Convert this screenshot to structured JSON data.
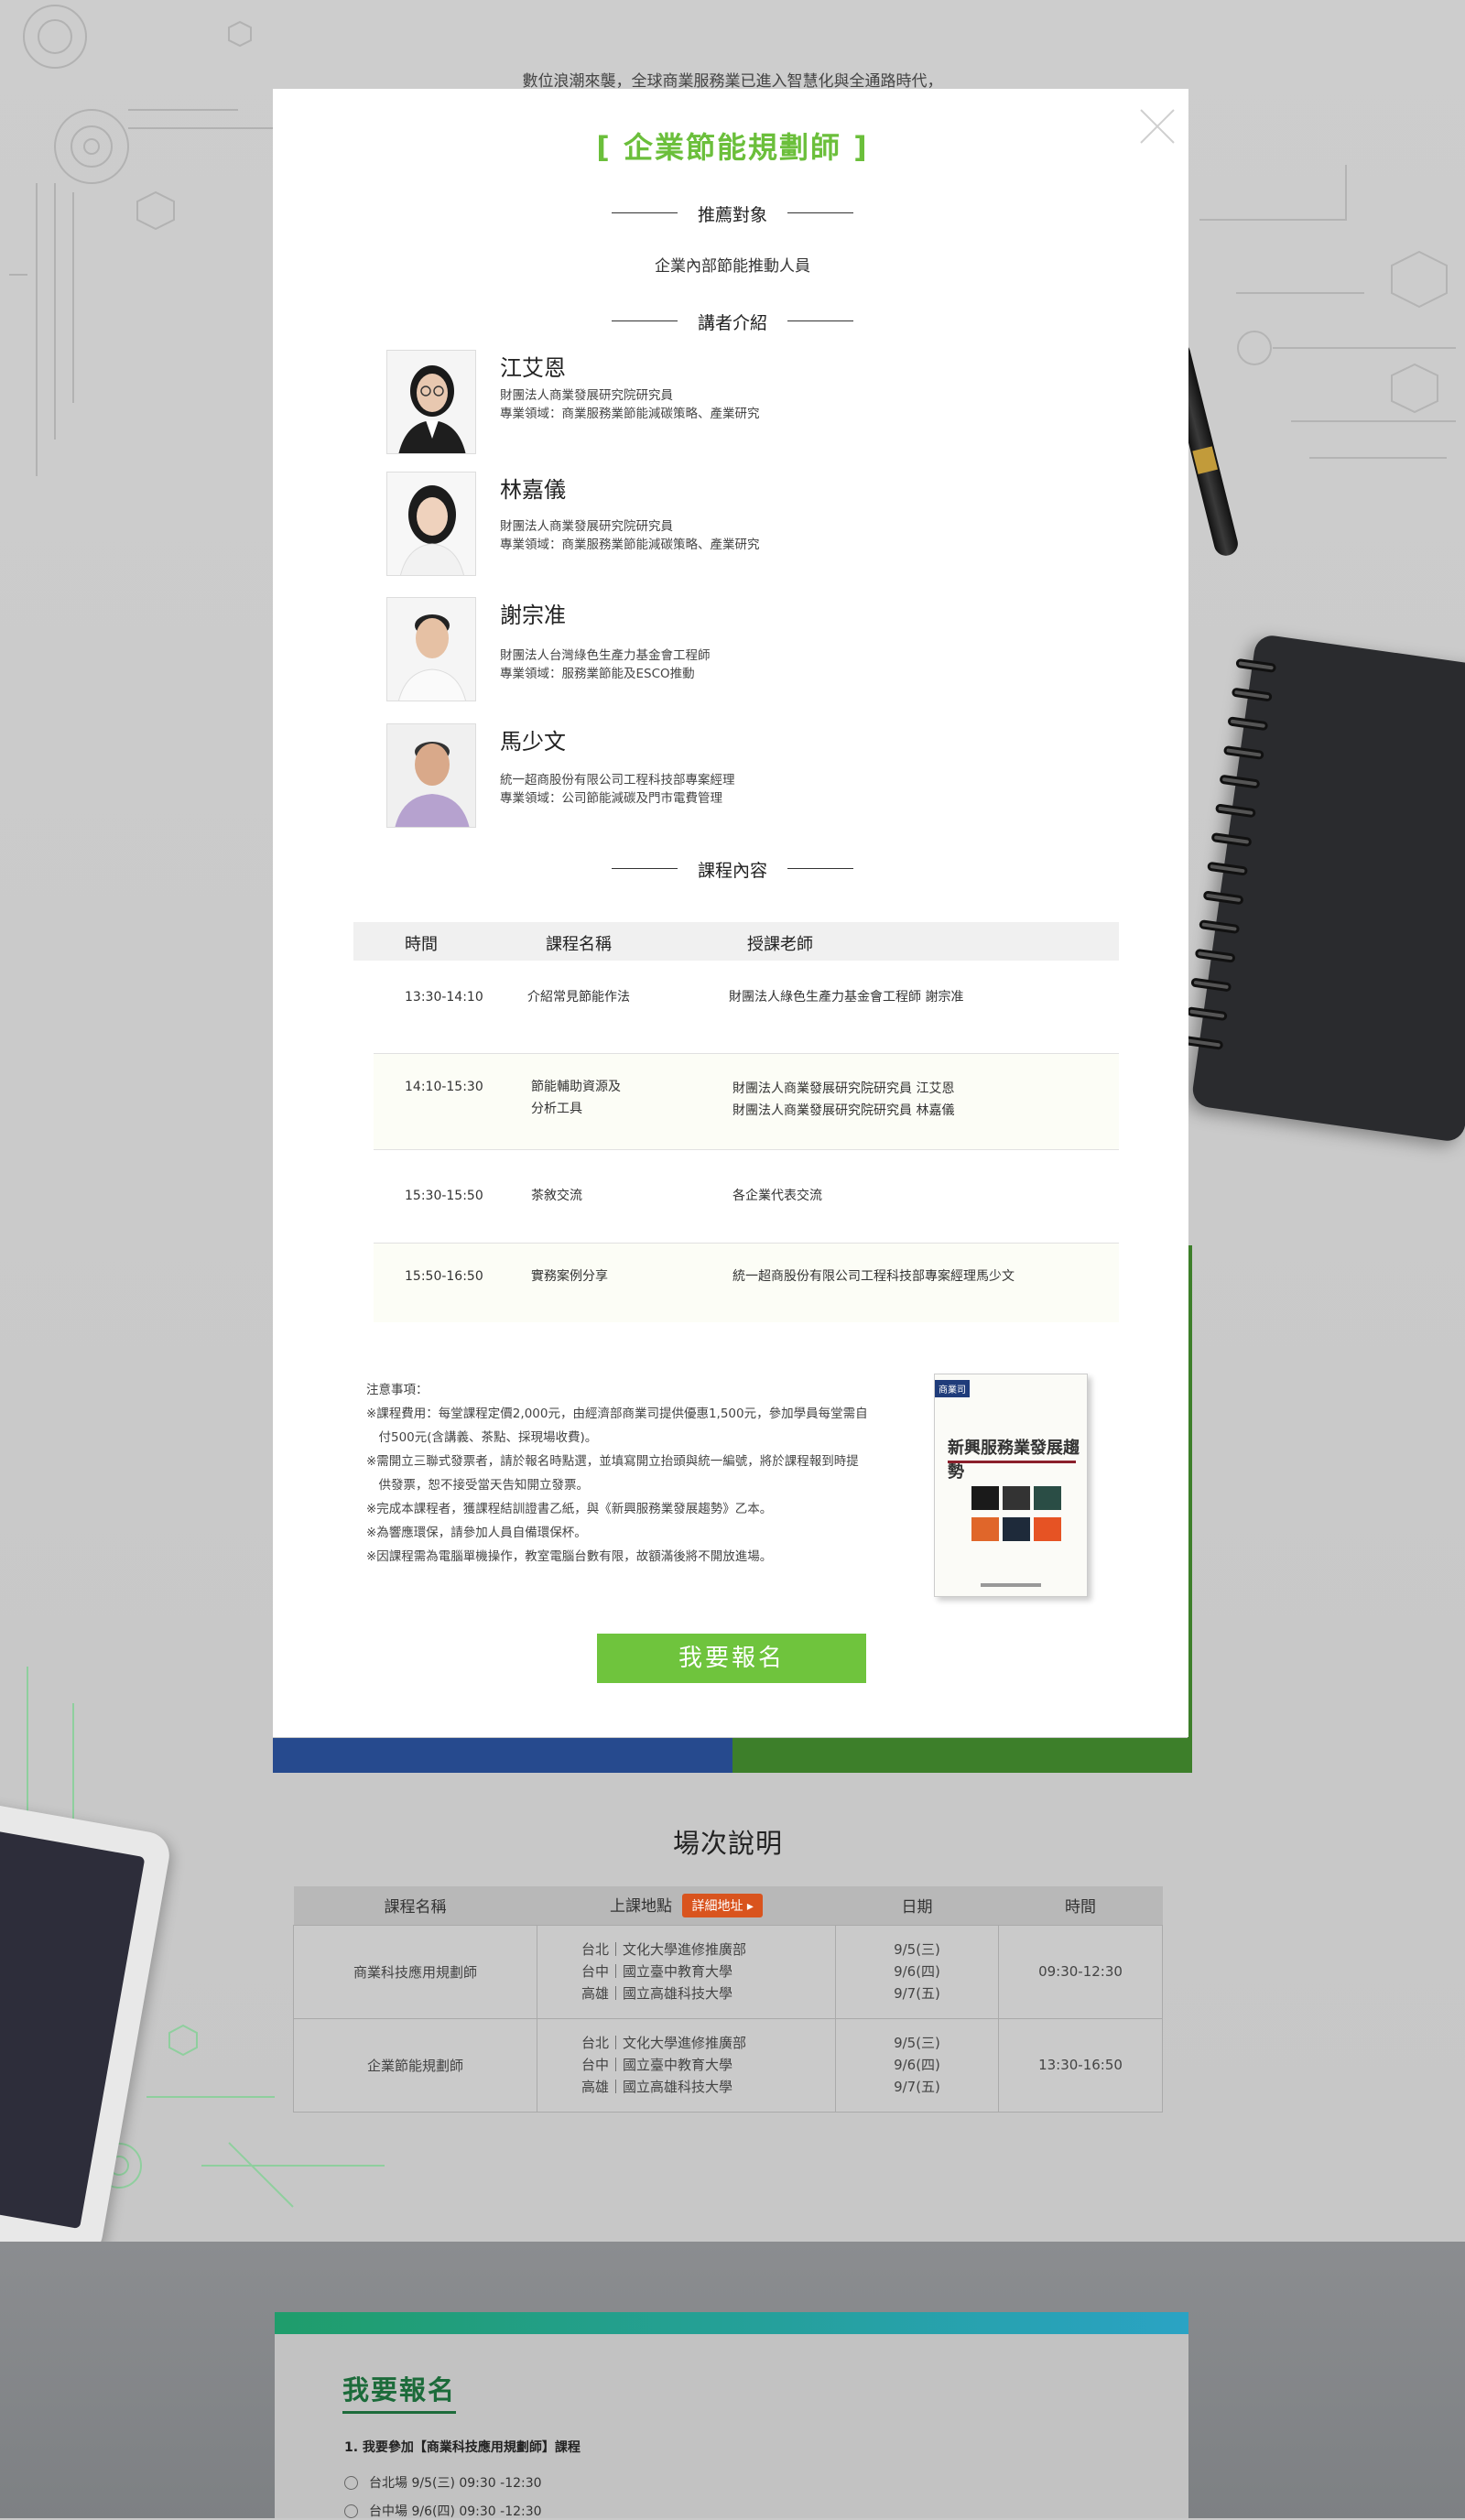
{
  "background": {
    "intro_text": "數位浪潮來襲，全球商業服務業已進入智慧化與全通路時代，"
  },
  "modal": {
    "title": "[ 企業節能規劃師 ]",
    "audience_heading": "推薦對象",
    "audience_text": "企業內部節能推動人員",
    "speakers_heading": "講者介紹",
    "speakers": [
      {
        "name": "江艾恩",
        "line1": "財團法人商業發展研究院研究員",
        "line2": "專業領域：商業服務業節能減碳策略、產業研究"
      },
      {
        "name": "林嘉儀",
        "line1": "財團法人商業發展研究院研究員",
        "line2": "專業領域：商業服務業節能減碳策略、產業研究"
      },
      {
        "name": "謝宗准",
        "line1": "財團法人台灣綠色生產力基金會工程師",
        "line2": "專業領域：服務業節能及ESCO推動"
      },
      {
        "name": "馬少文",
        "line1": "統一超商股份有限公司工程科技部專案經理",
        "line2": "專業領域：公司節能減碳及門市電費管理"
      }
    ],
    "course_heading": "課程內容",
    "course_table": {
      "headers": [
        "時間",
        "課程名稱",
        "授課老師"
      ],
      "rows": [
        {
          "time": "13:30-14:10",
          "name1": "介紹常見節能作法",
          "name2": "",
          "teacher1": "財團法人綠色生產力基金會工程師 謝宗准",
          "teacher2": ""
        },
        {
          "time": "14:10-15:30",
          "name1": "節能輔助資源及",
          "name2": "分析工具",
          "teacher1": "財團法人商業發展研究院研究員 江艾恩",
          "teacher2": "財團法人商業發展研究院研究員 林嘉儀"
        },
        {
          "time": "15:30-15:50",
          "name1": "茶敘交流",
          "name2": "",
          "teacher1": "各企業代表交流",
          "teacher2": ""
        },
        {
          "time": "15:50-16:50",
          "name1": "實務案例分享",
          "name2": "",
          "teacher1": "統一超商股份有限公司工程科技部專案經理馬少文",
          "teacher2": ""
        }
      ]
    },
    "notes": {
      "title": "注意事項：",
      "items": [
        "※課程費用：每堂課程定價2,000元，由經濟部商業司提供優惠1,500元，參加學員每堂需自",
        "　付500元(含講義、茶點、採現場收費)。",
        "※需開立三聯式發票者，請於報名時點選，並填寫開立抬頭與統一編號，將於課程報到時提",
        "　供發票，恕不接受當天告知開立發票。",
        "※完成本課程者，獲課程結訓證書乙紙，與《新興服務業發展趨勢》乙本。",
        "※為響應環保，請參加人員自備環保杯。",
        "※因課程需為電腦單機操作，教室電腦台數有限，故額滿後將不開放進場。"
      ]
    },
    "book": {
      "badge": "商業司",
      "title": "新興服務業發展趨勢"
    },
    "signup_label": "我要報名",
    "close_icon": "close-icon"
  },
  "sessions": {
    "title": "場次說明",
    "headers": {
      "course": "課程名稱",
      "location": "上課地點",
      "address_button": "詳細地址 ▸",
      "date": "日期",
      "time": "時間"
    },
    "rows": [
      {
        "course": "商業科技應用規劃師",
        "loc1": "台北｜文化大學進修推廣部",
        "loc2": "台中｜國立臺中教育大學",
        "loc3": "高雄｜國立高雄科技大學",
        "d1": "9/5(三)",
        "d2": "9/6(四)",
        "d3": "9/7(五)",
        "time": "09:30-12:30"
      },
      {
        "course": "企業節能規劃師",
        "loc1": "台北｜文化大學進修推廣部",
        "loc2": "台中｜國立臺中教育大學",
        "loc3": "高雄｜國立高雄科技大學",
        "d1": "9/5(三)",
        "d2": "9/6(四)",
        "d3": "9/7(五)",
        "time": "13:30-16:50"
      }
    ]
  },
  "registration": {
    "title": "我要報名",
    "question": "1. 我要參加【商業科技應用規劃師】課程",
    "options": [
      "台北場 9/5(三) 09:30 -12:30",
      "台中場 9/6(四) 09:30 -12:30"
    ]
  },
  "colors": {
    "accent_green": "#6fc43d",
    "title_green": "#6bbf3b",
    "address_orange": "#d9541e"
  }
}
